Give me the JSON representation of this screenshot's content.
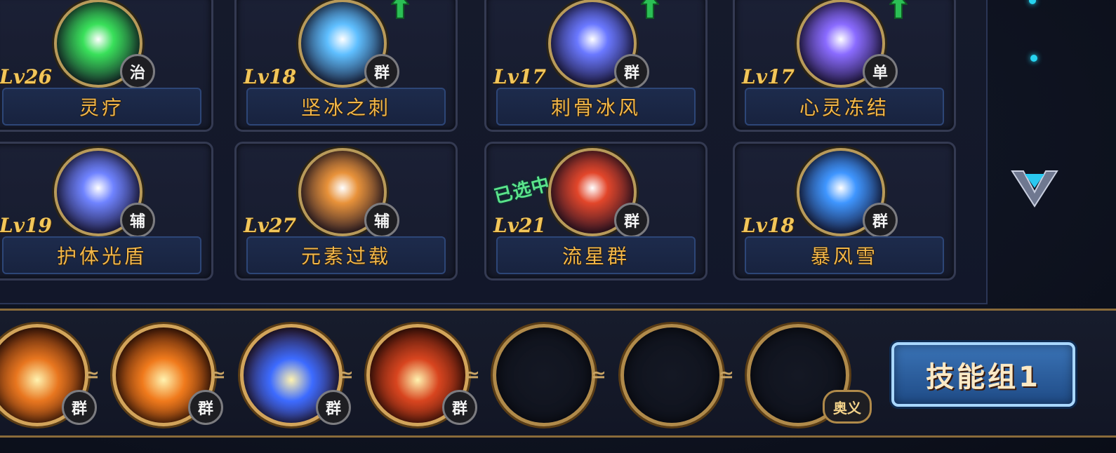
{
  "skills": [
    {
      "name": "灵疗",
      "level": "Lv26",
      "type": "治",
      "upgrade": false,
      "selected": false,
      "color": "#39e05a"
    },
    {
      "name": "坚冰之刺",
      "level": "Lv18",
      "type": "群",
      "upgrade": true,
      "selected": false,
      "color": "#5fbfff"
    },
    {
      "name": "刺骨冰风",
      "level": "Lv17",
      "type": "群",
      "upgrade": true,
      "selected": false,
      "color": "#6a78ff"
    },
    {
      "name": "心灵冻结",
      "level": "Lv17",
      "type": "单",
      "upgrade": true,
      "selected": false,
      "color": "#8a6bff"
    },
    {
      "name": "护体光盾",
      "level": "Lv19",
      "type": "辅",
      "upgrade": false,
      "selected": false,
      "color": "#6f83ff"
    },
    {
      "name": "元素过载",
      "level": "Lv27",
      "type": "辅",
      "upgrade": false,
      "selected": false,
      "color": "#e8923a"
    },
    {
      "name": "流星群",
      "level": "Lv21",
      "type": "群",
      "upgrade": false,
      "selected": true,
      "selected_label": "已选中",
      "color": "#e2462a"
    },
    {
      "name": "暴风雪",
      "level": "Lv18",
      "type": "群",
      "upgrade": false,
      "selected": false,
      "color": "#3f96ff"
    }
  ],
  "skill_bar": {
    "slots": [
      {
        "filled": true,
        "type": "群",
        "color": "#e8761f"
      },
      {
        "filled": true,
        "type": "群",
        "color": "#f07a1c"
      },
      {
        "filled": true,
        "type": "群",
        "color": "#3d6bff"
      },
      {
        "filled": true,
        "type": "群",
        "color": "#d8451f"
      },
      {
        "filled": false
      },
      {
        "filled": false
      },
      {
        "filled": false,
        "ultimate": true
      }
    ],
    "ultimate_label": "奥义",
    "group_button_label": "技能组1"
  },
  "chain_symbol": "≃"
}
